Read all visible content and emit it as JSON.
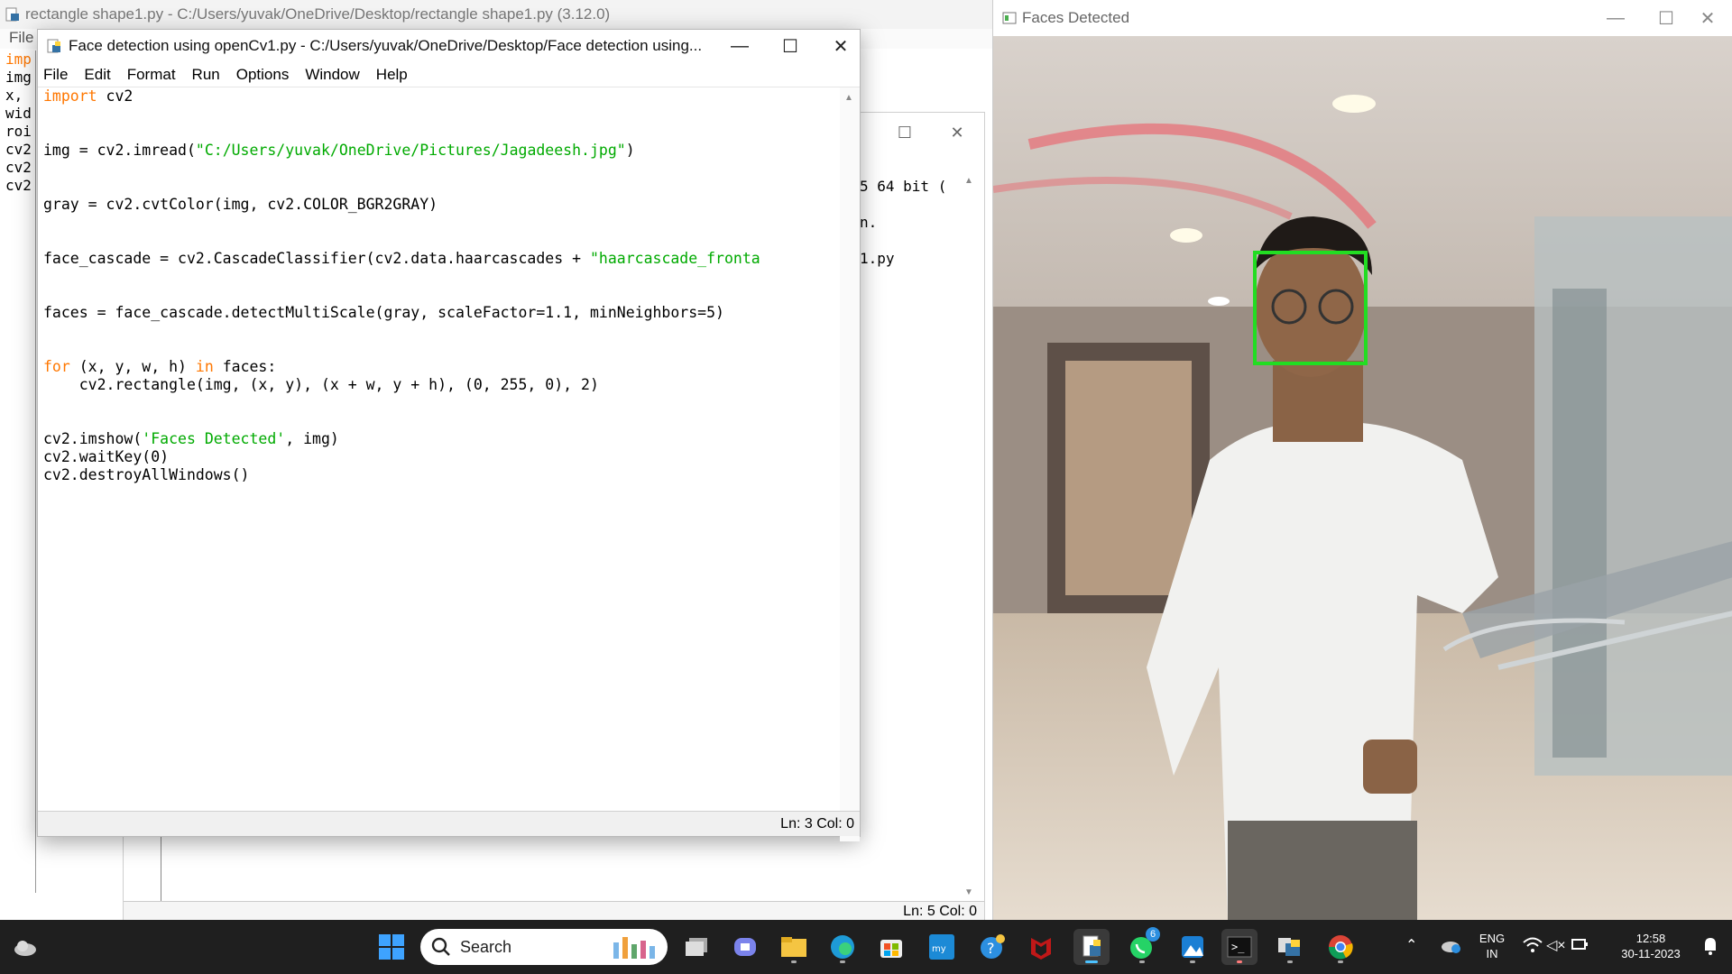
{
  "back_window": {
    "title": "rectangle shape1.py - C:/Users/yuvak/OneDrive/Desktop/rectangle shape1.py (3.12.0)",
    "menu_first": "File",
    "lines": [
      "imp",
      "img",
      "x,",
      "wid",
      "roi",
      "cv2",
      "cv2",
      "cv2"
    ]
  },
  "shell_window": {
    "lines": [
      "5 64 bit (",
      "n.",
      "1.py"
    ],
    "status": "Ln: 5  Col: 0"
  },
  "editor": {
    "title": "Face detection using openCv1.py - C:/Users/yuvak/OneDrive/Desktop/Face detection using...",
    "menu": [
      "File",
      "Edit",
      "Format",
      "Run",
      "Options",
      "Window",
      "Help"
    ],
    "code": {
      "l1_kw": "import",
      "l1_rest": " cv2",
      "l2_pre": "img = cv2.imread(",
      "l2_str": "\"C:/Users/yuvak/OneDrive/Pictures/Jagadeesh.jpg\"",
      "l2_post": ")",
      "l3": "gray = cv2.cvtColor(img, cv2.COLOR_BGR2GRAY)",
      "l4_pre": "face_cascade = cv2.CascadeClassifier(cv2.data.haarcascades + ",
      "l4_str": "\"haarcascade_fronta",
      "l5": "faces = face_cascade.detectMultiScale(gray, scaleFactor=1.1, minNeighbors=5)",
      "l6_kw1": "for",
      "l6_mid": " (x, y, w, h) ",
      "l6_kw2": "in",
      "l6_post": " faces:",
      "l7": "    cv2.rectangle(img, (x, y), (x + w, y + h), (0, 255, 0), 2)",
      "l8_pre": "cv2.imshow(",
      "l8_str": "'Faces Detected'",
      "l8_post": ", img)",
      "l9": "cv2.waitKey(0)",
      "l10": "cv2.destroyAllWindows()"
    },
    "status": "Ln: 3   Col: 0"
  },
  "faces_window": {
    "title": "Faces Detected",
    "detection_color": "#22dd22"
  },
  "taskbar": {
    "search_label": "Search",
    "whatsapp_badge": "6",
    "lang_top": "ENG",
    "lang_bottom": "IN",
    "time": "12:58",
    "date": "30-11-2023"
  },
  "colors": {
    "keyword": "#ff7700",
    "string": "#00aa00",
    "taskbar_bg": "#1f1f1f"
  }
}
